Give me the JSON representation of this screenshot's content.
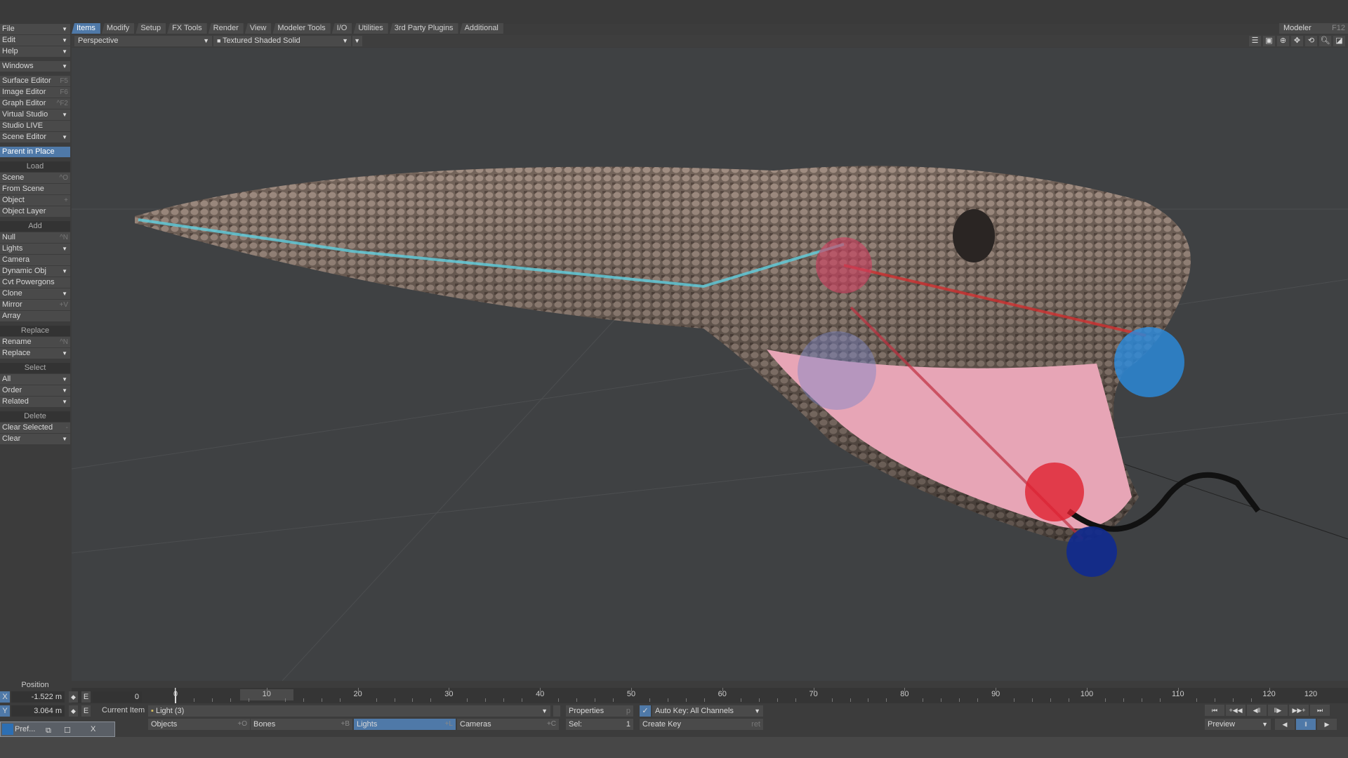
{
  "menu_tabs": [
    "Items",
    "Modify",
    "Setup",
    "FX Tools",
    "Render",
    "View",
    "Modeler Tools",
    "I/O",
    "Utilities",
    "3rd Party Plugins",
    "Additional"
  ],
  "modeler": {
    "label": "Modeler",
    "key": "F12"
  },
  "viewport": {
    "view": "Perspective",
    "shading": "Textured Shaded Solid"
  },
  "sidebar": {
    "top": [
      {
        "label": "File",
        "arrow": true
      },
      {
        "label": "Edit",
        "arrow": true
      },
      {
        "label": "Help",
        "arrow": true
      }
    ],
    "windows": {
      "label": "Windows"
    },
    "editors": [
      {
        "label": "Surface Editor",
        "key": "F5"
      },
      {
        "label": "Image Editor",
        "key": "F6"
      },
      {
        "label": "Graph Editor",
        "key": "^F2"
      },
      {
        "label": "Virtual Studio",
        "arrow": true
      },
      {
        "label": "Studio LIVE"
      },
      {
        "label": "Scene Editor",
        "arrow": true
      }
    ],
    "parent_in_place": "Parent in Place",
    "load": {
      "header": "Load",
      "items": [
        {
          "label": "Scene",
          "key": "^O"
        },
        {
          "label": "From Scene"
        },
        {
          "label": "Object",
          "key": "+"
        },
        {
          "label": "Object Layer"
        }
      ]
    },
    "add": {
      "header": "Add",
      "items": [
        {
          "label": "Null",
          "key": "^N"
        },
        {
          "label": "Lights",
          "arrow": true
        },
        {
          "label": "Camera"
        },
        {
          "label": "Dynamic Obj",
          "arrow": true
        },
        {
          "label": "Cvt Powergons"
        },
        {
          "label": "Clone",
          "arrow": true
        },
        {
          "label": "Mirror",
          "key": "+V"
        },
        {
          "label": "Array"
        }
      ]
    },
    "replace": {
      "header": "Replace",
      "items": [
        {
          "label": "Rename",
          "key": "^N"
        },
        {
          "label": "Replace",
          "arrow": true
        }
      ]
    },
    "select": {
      "header": "Select",
      "items": [
        {
          "label": "All",
          "arrow": true
        },
        {
          "label": "Order",
          "arrow": true
        },
        {
          "label": "Related",
          "arrow": true
        }
      ]
    },
    "delete": {
      "header": "Delete",
      "items": [
        {
          "label": "Clear Selected",
          "key": "-"
        },
        {
          "label": "Clear",
          "arrow": true
        }
      ]
    }
  },
  "position": {
    "label": "Position",
    "x_label": "X",
    "x": "-1.522 m",
    "y_label": "Y",
    "y": "3.064 m",
    "e": "E",
    "frame": "0"
  },
  "timeline": {
    "ticks": [
      "0",
      "10",
      "20",
      "30",
      "40",
      "50",
      "60",
      "70",
      "80",
      "90",
      "100",
      "110",
      "120"
    ],
    "end": "120",
    "current_frame": 0
  },
  "current_item": {
    "label": "Current Item",
    "value": "Light (3)"
  },
  "properties": {
    "label": "Properties",
    "key": "p"
  },
  "autokey": "Auto Key: All Channels",
  "create_key": {
    "label": "Create Key",
    "key": "ret"
  },
  "filters": [
    {
      "label": "Objects",
      "key": "+O"
    },
    {
      "label": "Bones",
      "key": "+B"
    },
    {
      "label": "Lights",
      "key": "+L",
      "active": true
    },
    {
      "label": "Cameras",
      "key": "+C"
    }
  ],
  "sel": {
    "label": "Sel:",
    "value": "1"
  },
  "preview": "Preview",
  "taskbar": {
    "label": "Pref...",
    "close": "X"
  }
}
